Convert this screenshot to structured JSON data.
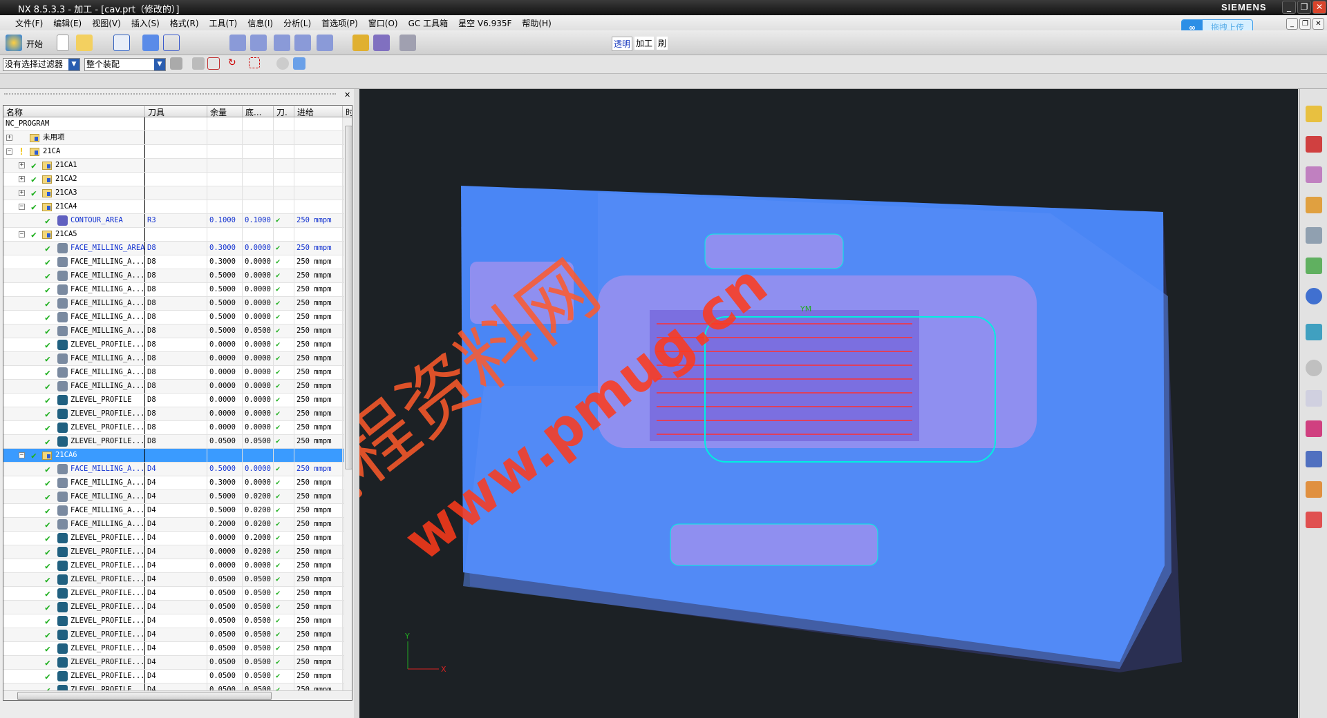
{
  "window": {
    "title": "NX 8.5.3.3 - 加工 - [cav.prt（修改的）]",
    "brand": "SIEMENS"
  },
  "menu": [
    "文件(F)",
    "编辑(E)",
    "视图(V)",
    "插入(S)",
    "格式(R)",
    "工具(T)",
    "信息(I)",
    "分析(L)",
    "首选项(P)",
    "窗口(O)",
    "GC 工具箱",
    "星空 V6.935F",
    "帮助(H)"
  ],
  "toolbar": {
    "start_label": "开始",
    "app_buttons": [
      "透明",
      "加工",
      "刷"
    ]
  },
  "upload": {
    "label": "拖拽上传"
  },
  "filters": {
    "selection_filter": "没有选择过滤器",
    "assembly_scope": "整个装配"
  },
  "table": {
    "columns": [
      "名称",
      "刀具",
      "余量",
      "底...",
      "刀.",
      "进给",
      "时"
    ],
    "rows": [
      {
        "level": 0,
        "name": "NC_PROGRAM",
        "type": "root"
      },
      {
        "level": 1,
        "name": "未用项",
        "type": "group",
        "exp": "+"
      },
      {
        "level": 1,
        "name": "21CA",
        "type": "group",
        "exp": "-",
        "status": "warning"
      },
      {
        "level": 2,
        "name": "21CA1",
        "type": "group",
        "exp": "+",
        "status": "ok"
      },
      {
        "level": 2,
        "name": "21CA2",
        "type": "group",
        "exp": "+",
        "status": "ok"
      },
      {
        "level": 2,
        "name": "21CA3",
        "type": "group",
        "exp": "+",
        "status": "ok"
      },
      {
        "level": 2,
        "name": "21CA4",
        "type": "group",
        "exp": "-",
        "status": "ok"
      },
      {
        "level": 3,
        "name": "CONTOUR_AREA",
        "type": "contour",
        "tool": "R3",
        "stock": "0.1000",
        "floor": "0.1000",
        "feed": "250 mmpm",
        "status": "ok",
        "blue": true
      },
      {
        "level": 2,
        "name": "21CA5",
        "type": "group",
        "exp": "-",
        "status": "ok"
      },
      {
        "level": 3,
        "name": "FACE_MILLING_AREA",
        "type": "face",
        "tool": "D8",
        "stock": "0.3000",
        "floor": "0.0000",
        "feed": "250 mmpm",
        "status": "ok",
        "blue": true
      },
      {
        "level": 3,
        "name": "FACE_MILLING_A...",
        "type": "face",
        "tool": "D8",
        "stock": "0.3000",
        "floor": "0.0000",
        "feed": "250 mmpm",
        "status": "ok"
      },
      {
        "level": 3,
        "name": "FACE_MILLING_A...",
        "type": "face",
        "tool": "D8",
        "stock": "0.5000",
        "floor": "0.0000",
        "feed": "250 mmpm",
        "status": "ok"
      },
      {
        "level": 3,
        "name": "FACE_MILLING_A...",
        "type": "face",
        "tool": "D8",
        "stock": "0.5000",
        "floor": "0.0000",
        "feed": "250 mmpm",
        "status": "ok"
      },
      {
        "level": 3,
        "name": "FACE_MILLING_A...",
        "type": "face",
        "tool": "D8",
        "stock": "0.5000",
        "floor": "0.0000",
        "feed": "250 mmpm",
        "status": "ok"
      },
      {
        "level": 3,
        "name": "FACE_MILLING_A...",
        "type": "face",
        "tool": "D8",
        "stock": "0.5000",
        "floor": "0.0000",
        "feed": "250 mmpm",
        "status": "ok"
      },
      {
        "level": 3,
        "name": "FACE_MILLING_A...",
        "type": "face",
        "tool": "D8",
        "stock": "0.5000",
        "floor": "0.0500",
        "feed": "250 mmpm",
        "status": "ok"
      },
      {
        "level": 3,
        "name": "ZLEVEL_PROFILE...",
        "type": "zlevel",
        "tool": "D8",
        "stock": "0.0000",
        "floor": "0.0000",
        "feed": "250 mmpm",
        "status": "ok"
      },
      {
        "level": 3,
        "name": "FACE_MILLING_A...",
        "type": "face",
        "tool": "D8",
        "stock": "0.0000",
        "floor": "0.0000",
        "feed": "250 mmpm",
        "status": "ok"
      },
      {
        "level": 3,
        "name": "FACE_MILLING_A...",
        "type": "face",
        "tool": "D8",
        "stock": "0.0000",
        "floor": "0.0000",
        "feed": "250 mmpm",
        "status": "ok"
      },
      {
        "level": 3,
        "name": "FACE_MILLING_A...",
        "type": "face",
        "tool": "D8",
        "stock": "0.0000",
        "floor": "0.0000",
        "feed": "250 mmpm",
        "status": "ok"
      },
      {
        "level": 3,
        "name": "ZLEVEL_PROFILE",
        "type": "zlevel",
        "tool": "D8",
        "stock": "0.0000",
        "floor": "0.0000",
        "feed": "250 mmpm",
        "status": "ok"
      },
      {
        "level": 3,
        "name": "ZLEVEL_PROFILE...",
        "type": "zlevel",
        "tool": "D8",
        "stock": "0.0000",
        "floor": "0.0000",
        "feed": "250 mmpm",
        "status": "ok"
      },
      {
        "level": 3,
        "name": "ZLEVEL_PROFILE...",
        "type": "zlevel",
        "tool": "D8",
        "stock": "0.0000",
        "floor": "0.0000",
        "feed": "250 mmpm",
        "status": "ok"
      },
      {
        "level": 3,
        "name": "ZLEVEL_PROFILE...",
        "type": "zlevel",
        "tool": "D8",
        "stock": "0.0500",
        "floor": "0.0500",
        "feed": "250 mmpm",
        "status": "ok"
      },
      {
        "level": 2,
        "name": "21CA6",
        "type": "group",
        "exp": "-",
        "status": "ok",
        "selected": true
      },
      {
        "level": 3,
        "name": "FACE_MILLING_A...",
        "type": "face",
        "tool": "D4",
        "stock": "0.5000",
        "floor": "0.0000",
        "feed": "250 mmpm",
        "status": "ok",
        "blue": true
      },
      {
        "level": 3,
        "name": "FACE_MILLING_A...",
        "type": "face",
        "tool": "D4",
        "stock": "0.3000",
        "floor": "0.0000",
        "feed": "250 mmpm",
        "status": "ok"
      },
      {
        "level": 3,
        "name": "FACE_MILLING_A...",
        "type": "face",
        "tool": "D4",
        "stock": "0.5000",
        "floor": "0.0200",
        "feed": "250 mmpm",
        "status": "ok"
      },
      {
        "level": 3,
        "name": "FACE_MILLING_A...",
        "type": "face",
        "tool": "D4",
        "stock": "0.5000",
        "floor": "0.0200",
        "feed": "250 mmpm",
        "status": "ok"
      },
      {
        "level": 3,
        "name": "FACE_MILLING_A...",
        "type": "face",
        "tool": "D4",
        "stock": "0.2000",
        "floor": "0.0200",
        "feed": "250 mmpm",
        "status": "ok"
      },
      {
        "level": 3,
        "name": "ZLEVEL_PROFILE...",
        "type": "zlevel",
        "tool": "D4",
        "stock": "0.0000",
        "floor": "0.2000",
        "feed": "250 mmpm",
        "status": "ok"
      },
      {
        "level": 3,
        "name": "ZLEVEL_PROFILE...",
        "type": "zlevel",
        "tool": "D4",
        "stock": "0.0000",
        "floor": "0.0200",
        "feed": "250 mmpm",
        "status": "ok"
      },
      {
        "level": 3,
        "name": "ZLEVEL_PROFILE...",
        "type": "zlevel",
        "tool": "D4",
        "stock": "0.0000",
        "floor": "0.0000",
        "feed": "250 mmpm",
        "status": "ok"
      },
      {
        "level": 3,
        "name": "ZLEVEL_PROFILE...",
        "type": "zlevel",
        "tool": "D4",
        "stock": "0.0500",
        "floor": "0.0500",
        "feed": "250 mmpm",
        "status": "ok"
      },
      {
        "level": 3,
        "name": "ZLEVEL_PROFILE...",
        "type": "zlevel",
        "tool": "D4",
        "stock": "0.0500",
        "floor": "0.0500",
        "feed": "250 mmpm",
        "status": "ok"
      },
      {
        "level": 3,
        "name": "ZLEVEL_PROFILE...",
        "type": "zlevel",
        "tool": "D4",
        "stock": "0.0500",
        "floor": "0.0500",
        "feed": "250 mmpm",
        "status": "ok"
      },
      {
        "level": 3,
        "name": "ZLEVEL_PROFILE...",
        "type": "zlevel",
        "tool": "D4",
        "stock": "0.0500",
        "floor": "0.0500",
        "feed": "250 mmpm",
        "status": "ok"
      },
      {
        "level": 3,
        "name": "ZLEVEL_PROFILE...",
        "type": "zlevel",
        "tool": "D4",
        "stock": "0.0500",
        "floor": "0.0500",
        "feed": "250 mmpm",
        "status": "ok"
      },
      {
        "level": 3,
        "name": "ZLEVEL_PROFILE...",
        "type": "zlevel",
        "tool": "D4",
        "stock": "0.0500",
        "floor": "0.0500",
        "feed": "250 mmpm",
        "status": "ok"
      },
      {
        "level": 3,
        "name": "ZLEVEL_PROFILE...",
        "type": "zlevel",
        "tool": "D4",
        "stock": "0.0500",
        "floor": "0.0500",
        "feed": "250 mmpm",
        "status": "ok"
      },
      {
        "level": 3,
        "name": "ZLEVEL_PROFILE...",
        "type": "zlevel",
        "tool": "D4",
        "stock": "0.0500",
        "floor": "0.0500",
        "feed": "250 mmpm",
        "status": "ok"
      },
      {
        "level": 3,
        "name": "ZLEVEL_PROFILE",
        "type": "zlevel",
        "tool": "D4",
        "stock": "0.0500",
        "floor": "0.0500",
        "feed": "250 mmpm",
        "status": "ok"
      }
    ]
  },
  "viewport": {
    "axis_labels": {
      "x": "X",
      "y": "Y",
      "ym": "YM"
    },
    "watermark": {
      "cn": "编程资料网",
      "url": "www.pmug.cn"
    }
  },
  "colors": {
    "mold": "#4a86f5",
    "part": "#8f8ff0",
    "toolpath_red": "#ff3030",
    "toolpath_cyan": "#00f0e0",
    "watermark": "#ff5a2a",
    "selection": "#3a9bff",
    "check": "#20b020"
  }
}
